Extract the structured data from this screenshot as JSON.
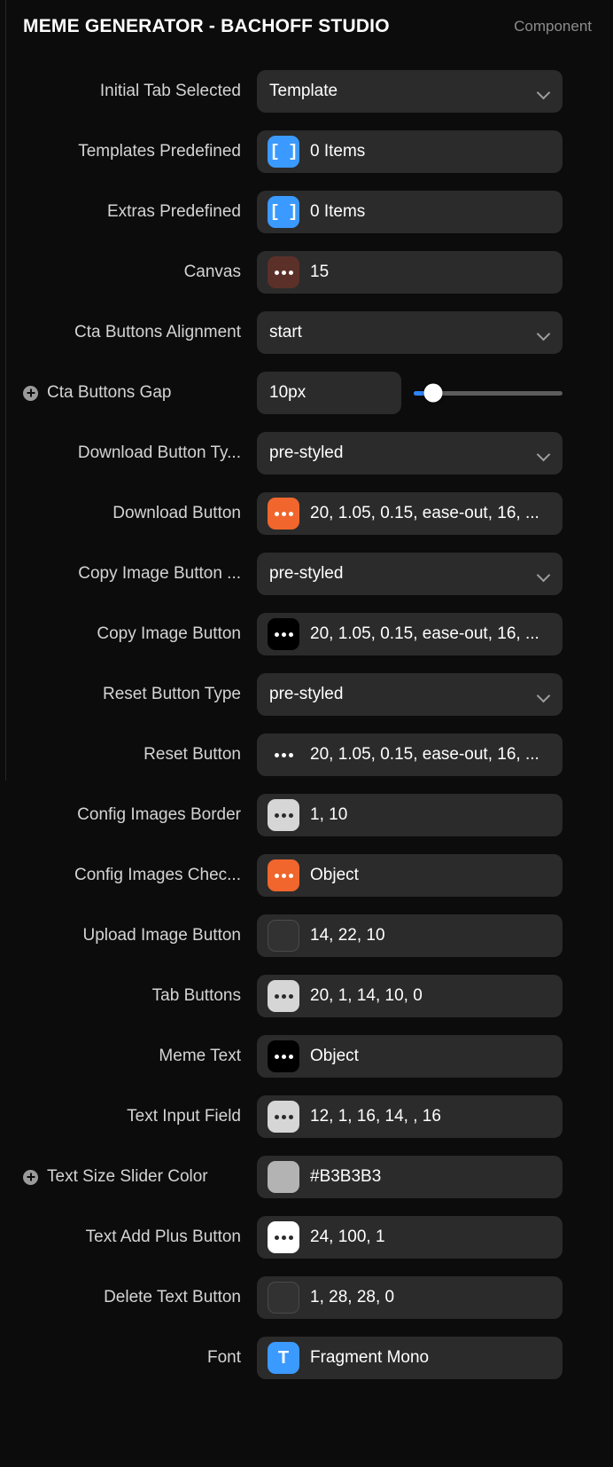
{
  "header": {
    "title": "MEME GENERATOR - BACHOFF STUDIO",
    "kind": "Component"
  },
  "slider": {
    "fill_percent": 13,
    "knob_percent": 13
  },
  "properties": [
    {
      "label": "Initial Tab Selected",
      "control": "select",
      "value": "Template",
      "badge": false
    },
    {
      "label": "Templates Predefined",
      "control": "array",
      "value": "0 Items",
      "icon": "array-brackets-icon",
      "icon_color": "blue",
      "badge": false
    },
    {
      "label": "Extras Predefined",
      "control": "array",
      "value": "0 Items",
      "icon": "array-brackets-icon",
      "icon_color": "blue",
      "badge": false
    },
    {
      "label": "Canvas",
      "control": "object",
      "value": "15",
      "icon": "three-dots-icon",
      "icon_color": "brown",
      "badge": false
    },
    {
      "label": "Cta Buttons Alignment",
      "control": "select",
      "value": "start",
      "badge": false
    },
    {
      "label": "Cta Buttons Gap",
      "control": "number-slider",
      "value": "10px",
      "badge": true
    },
    {
      "label": "Download Button Ty...",
      "control": "select",
      "value": "pre-styled",
      "badge": false
    },
    {
      "label": "Download Button",
      "control": "object",
      "value": "20, 1.05, 0.15, ease-out, 16, ...",
      "icon": "three-dots-icon",
      "icon_color": "orange",
      "badge": false
    },
    {
      "label": "Copy Image Button ...",
      "control": "select",
      "value": "pre-styled",
      "badge": false
    },
    {
      "label": "Copy Image Button",
      "control": "object",
      "value": "20, 1.05, 0.15, ease-out, 16, ...",
      "icon": "three-dots-icon",
      "icon_color": "black",
      "badge": false
    },
    {
      "label": "Reset Button Type",
      "control": "select",
      "value": "pre-styled",
      "badge": false
    },
    {
      "label": "Reset Button",
      "control": "object",
      "value": "20, 1.05, 0.15, ease-out, 16, ...",
      "icon": "three-dots-icon",
      "icon_color": "field",
      "badge": false
    },
    {
      "label": "Config Images Border",
      "control": "object",
      "value": "1, 10",
      "icon": "three-dots-icon",
      "icon_color": "lightgray",
      "badge": false
    },
    {
      "label": "Config Images Chec...",
      "control": "object",
      "value": "Object",
      "icon": "three-dots-icon",
      "icon_color": "orange",
      "badge": false
    },
    {
      "label": "Upload Image Button",
      "control": "object",
      "value": "14, 22, 10",
      "icon": "empty-swatch-icon",
      "icon_color": "empty",
      "badge": false
    },
    {
      "label": "Tab Buttons",
      "control": "object",
      "value": "20, 1, 14, 10, 0",
      "icon": "three-dots-icon",
      "icon_color": "lightgray",
      "badge": false
    },
    {
      "label": "Meme Text",
      "control": "object",
      "value": "Object",
      "icon": "three-dots-icon",
      "icon_color": "black",
      "badge": false
    },
    {
      "label": "Text Input Field",
      "control": "object",
      "value": "12, 1, 16, 14, , 16",
      "icon": "three-dots-icon",
      "icon_color": "lightgray",
      "badge": false
    },
    {
      "label": "Text Size Slider Color",
      "control": "color",
      "value": "#B3B3B3",
      "icon": "color-swatch-icon",
      "icon_color": "gray",
      "badge": true
    },
    {
      "label": "Text Add Plus Button",
      "control": "object",
      "value": "24, 100, 1",
      "icon": "three-dots-icon",
      "icon_color": "white",
      "badge": false
    },
    {
      "label": "Delete Text Button",
      "control": "object",
      "value": "1, 28, 28, 0",
      "icon": "empty-swatch-icon",
      "icon_color": "empty",
      "badge": false
    },
    {
      "label": "Font",
      "control": "font",
      "value": "Fragment Mono",
      "icon": "font-t-icon",
      "icon_color": "blue",
      "badge": false
    }
  ],
  "colors": {
    "panel_bg": "#0c0c0c",
    "field_bg": "#2b2b2b",
    "accent_blue": "#3b9aff",
    "accent_orange": "#f0662c",
    "slider_blue": "#2f84f5",
    "label_text": "#d4d4d4",
    "muted_text": "#8c8c8c"
  }
}
